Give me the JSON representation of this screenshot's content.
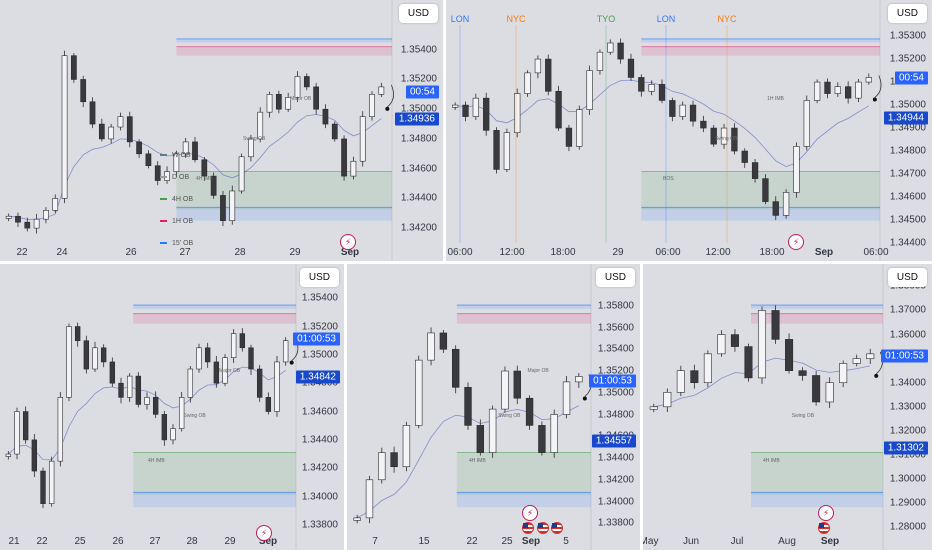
{
  "colors": {
    "background": "#dcdde3",
    "candle_up": "#f4f4f7",
    "candle_down": "#3a3a3e",
    "wick": "#2a2a2e",
    "ob_15m": "#2979ff",
    "ob_1h": "#e91e63",
    "ob_4h": "#43a047",
    "ob_daily": "#9e9e9e",
    "ob_weekly": "#607d8b",
    "ma_line": "#5c6bc0",
    "price_tag": "#2962ff"
  },
  "icons": {
    "event": "lightning-bolt-icon",
    "us_event": "us-flag-icon"
  },
  "chart_data": [
    {
      "id": "p1",
      "type": "candlestick",
      "currency_label": "USD",
      "yticks": [
        "1.35400",
        "1.35200",
        "1.35000",
        "1.34800",
        "1.34600",
        "1.34400",
        "1.34200"
      ],
      "ylim": [
        1.341,
        1.356
      ],
      "xticks": [
        "22",
        "24",
        "26",
        "27",
        "28",
        "29",
        "Sep"
      ],
      "price_labels": [
        {
          "text": "00:54",
          "value": 1.35118,
          "style": "blue"
        },
        {
          "text": "1.34936",
          "value": 1.34936,
          "style": "navy"
        }
      ],
      "legend": [
        "W OB",
        "D OB",
        "4H OB",
        "1H OB",
        "15' OB"
      ],
      "annotations": [
        "4H IMB",
        "Swing OB",
        "Major OB"
      ],
      "close_path": [
        1.3428,
        1.3424,
        1.342,
        1.3426,
        1.3432,
        1.344,
        1.3536,
        1.352,
        1.3505,
        1.349,
        1.348,
        1.3488,
        1.3495,
        1.3478,
        1.347,
        1.3462,
        1.3452,
        1.3458,
        1.347,
        1.3478,
        1.3466,
        1.3455,
        1.3442,
        1.3425,
        1.3445,
        1.3468,
        1.348,
        1.3498,
        1.351,
        1.35,
        1.3508,
        1.3522,
        1.3515,
        1.35,
        1.349,
        1.348,
        1.3455,
        1.3465,
        1.3495,
        1.351,
        1.3515
      ]
    },
    {
      "id": "p2",
      "type": "candlestick",
      "currency_label": "USD",
      "yticks": [
        "1.35300",
        "1.35200",
        "1.35100",
        "1.35000",
        "1.34900",
        "1.34800",
        "1.34700",
        "1.34600",
        "1.34500",
        "1.34400"
      ],
      "ylim": [
        1.344,
        1.3537
      ],
      "xticks": [
        "06:00",
        "12:00",
        "18:00",
        "29",
        "06:00",
        "12:00",
        "18:00",
        "Sep",
        "06:00"
      ],
      "sessions": [
        {
          "label": "LON",
          "color": "#2979ff"
        },
        {
          "label": "NYC",
          "color": "#f57c00"
        },
        {
          "label": "TYO",
          "color": "#43a047"
        },
        {
          "label": "LON",
          "color": "#2979ff"
        },
        {
          "label": "NYC",
          "color": "#f57c00"
        }
      ],
      "price_labels": [
        {
          "text": "00:54",
          "value": 1.35118,
          "style": "blue"
        },
        {
          "text": "1.34944",
          "value": 1.34944,
          "style": "navy"
        }
      ],
      "annotations": [
        "BOS",
        "Swing OB",
        "1H IMB"
      ],
      "close_path": [
        1.35,
        1.3495,
        1.3503,
        1.3489,
        1.3472,
        1.3488,
        1.3505,
        1.3514,
        1.352,
        1.3506,
        1.349,
        1.3482,
        1.3498,
        1.3515,
        1.3523,
        1.3527,
        1.352,
        1.3512,
        1.3506,
        1.3509,
        1.3502,
        1.3495,
        1.35,
        1.3493,
        1.349,
        1.3483,
        1.349,
        1.348,
        1.3475,
        1.3468,
        1.3458,
        1.3452,
        1.3462,
        1.3482,
        1.3502,
        1.351,
        1.3505,
        1.3508,
        1.3503,
        1.351,
        1.3512
      ]
    },
    {
      "id": "p3",
      "type": "candlestick",
      "currency_label": "USD",
      "yticks": [
        "1.35400",
        "1.35200",
        "1.35000",
        "1.34800",
        "1.34600",
        "1.34400",
        "1.34200",
        "1.34000",
        "1.33800"
      ],
      "ylim": [
        1.3375,
        1.355
      ],
      "xticks": [
        "21",
        "22",
        "25",
        "26",
        "27",
        "28",
        "29",
        "Sep"
      ],
      "price_labels": [
        {
          "text": "01:00:53",
          "value": 1.35112,
          "style": "blue"
        },
        {
          "text": "1.34842",
          "value": 1.34842,
          "style": "navy"
        }
      ],
      "annotations": [
        "4H IMB",
        "Swing OB",
        "Major OB"
      ],
      "close_path": [
        1.343,
        1.346,
        1.344,
        1.3418,
        1.3395,
        1.3425,
        1.347,
        1.352,
        1.351,
        1.349,
        1.3505,
        1.3495,
        1.348,
        1.347,
        1.3485,
        1.3465,
        1.347,
        1.3458,
        1.344,
        1.3448,
        1.347,
        1.349,
        1.3505,
        1.3495,
        1.348,
        1.3498,
        1.3515,
        1.3505,
        1.349,
        1.347,
        1.346,
        1.3495,
        1.351
      ]
    },
    {
      "id": "p4",
      "type": "candlestick",
      "currency_label": "USD",
      "yticks": [
        "1.35800",
        "1.35600",
        "1.35400",
        "1.35200",
        "1.35000",
        "1.34800",
        "1.34600",
        "1.34400",
        "1.34200",
        "1.34000",
        "1.33800"
      ],
      "ylim": [
        1.3372,
        1.36
      ],
      "xticks": [
        "7",
        "15",
        "22",
        "25",
        "Sep",
        "5"
      ],
      "price_labels": [
        {
          "text": "01:00:53",
          "value": 1.35112,
          "style": "blue"
        },
        {
          "text": "1.34557",
          "value": 1.34557,
          "style": "navy"
        }
      ],
      "annotations": [
        "4H IMB",
        "Swing OB",
        "Major OB"
      ],
      "close_path": [
        1.3385,
        1.342,
        1.3445,
        1.3432,
        1.347,
        1.353,
        1.3555,
        1.354,
        1.3505,
        1.347,
        1.3445,
        1.3485,
        1.352,
        1.3495,
        1.347,
        1.3445,
        1.348,
        1.351,
        1.3515
      ]
    },
    {
      "id": "p5",
      "type": "candlestick",
      "currency_label": "USD",
      "yticks": [
        "1.38000",
        "1.37000",
        "1.36000",
        "1.35000",
        "1.34000",
        "1.33000",
        "1.32000",
        "1.31000",
        "1.30000",
        "1.29000",
        "1.28000"
      ],
      "ylim": [
        1.278,
        1.381
      ],
      "xticks": [
        "May",
        "Jun",
        "Jul",
        "Aug",
        "Sep"
      ],
      "price_labels": [
        {
          "text": "01:00:53",
          "value": 1.35112,
          "style": "blue"
        },
        {
          "text": "1.31302",
          "value": 1.31302,
          "style": "navy"
        }
      ],
      "annotations": [
        "4H IMB",
        "Swing OB"
      ],
      "close_path": [
        1.33,
        1.336,
        1.345,
        1.34,
        1.352,
        1.36,
        1.355,
        1.342,
        1.37,
        1.358,
        1.345,
        1.343,
        1.332,
        1.34,
        1.348,
        1.35,
        1.352
      ]
    }
  ]
}
